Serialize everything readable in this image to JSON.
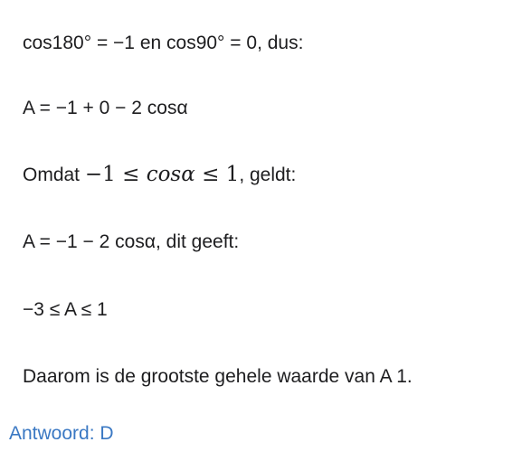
{
  "lines": {
    "l1": "cos180° = −1 en cos90° = 0, dus:",
    "l2": "A = −1 + 0 − 2 cosα",
    "l3_text": "Omdat",
    "l3_math": {
      "neg_one": "−1",
      "leq1": "≤",
      "cos": "cosα",
      "leq2": "≤",
      "one": "1"
    },
    "l3_tail": ", geldt:",
    "l4": "A = −1 − 2 cosα, dit geeft:",
    "l5": "−3 ≤ A ≤ 1",
    "l6": "Daarom is de grootste gehele waarde van A 1."
  },
  "answer": "Antwoord: D"
}
